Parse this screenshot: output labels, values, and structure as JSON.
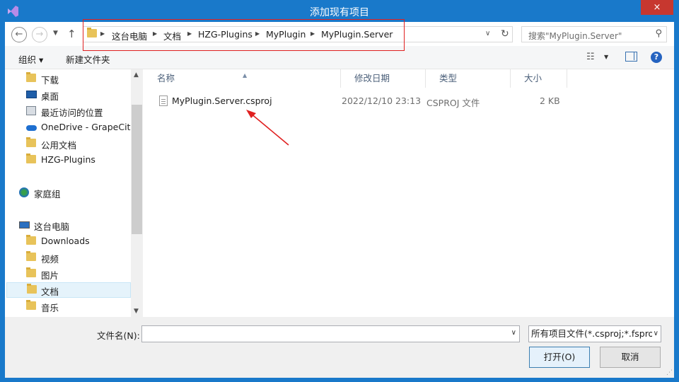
{
  "window": {
    "title": "添加现有项目",
    "close_icon": "×"
  },
  "nav": {
    "address": [
      "这台电脑",
      "文档",
      "HZG-Plugins",
      "MyPlugin",
      "MyPlugin.Server"
    ],
    "search_placeholder": "搜索\"MyPlugin.Server\""
  },
  "toolbar": {
    "organize_label": "组织 ▾",
    "new_folder_label": "新建文件夹"
  },
  "sidebar": {
    "items": [
      {
        "label": "下载",
        "icon": "download-folder-icon"
      },
      {
        "label": "桌面",
        "icon": "desktop-icon"
      },
      {
        "label": "最近访问的位置",
        "icon": "recent-places-icon"
      },
      {
        "label": "OneDrive - GrapeCity",
        "icon": "onedrive-icon"
      },
      {
        "label": "公用文档",
        "icon": "folder-icon"
      },
      {
        "label": "HZG-Plugins",
        "icon": "folder-icon"
      },
      {
        "label": "家庭组",
        "icon": "homegroup-icon"
      },
      {
        "label": "这台电脑",
        "icon": "computer-icon"
      },
      {
        "label": "Downloads",
        "icon": "folder-icon"
      },
      {
        "label": "视频",
        "icon": "videos-folder-icon"
      },
      {
        "label": "图片",
        "icon": "pictures-folder-icon"
      },
      {
        "label": "文档",
        "icon": "documents-folder-icon"
      },
      {
        "label": "音乐",
        "icon": "music-folder-icon"
      }
    ]
  },
  "columns": [
    "名称",
    "修改日期",
    "类型",
    "大小"
  ],
  "files": [
    {
      "name": "MyPlugin.Server.csproj",
      "modified": "2022/12/10 23:13",
      "type": "CSPROJ 文件",
      "size": "2 KB"
    }
  ],
  "footer": {
    "filename_label": "文件名(N):",
    "filename_value": "",
    "filter_label": "所有项目文件(*.csproj;*.fsproj",
    "open_label": "打开(O)",
    "cancel_label": "取消"
  },
  "colors": {
    "titlebar": "#1979ca",
    "close": "#c7372f",
    "annotation": "#e02020"
  }
}
